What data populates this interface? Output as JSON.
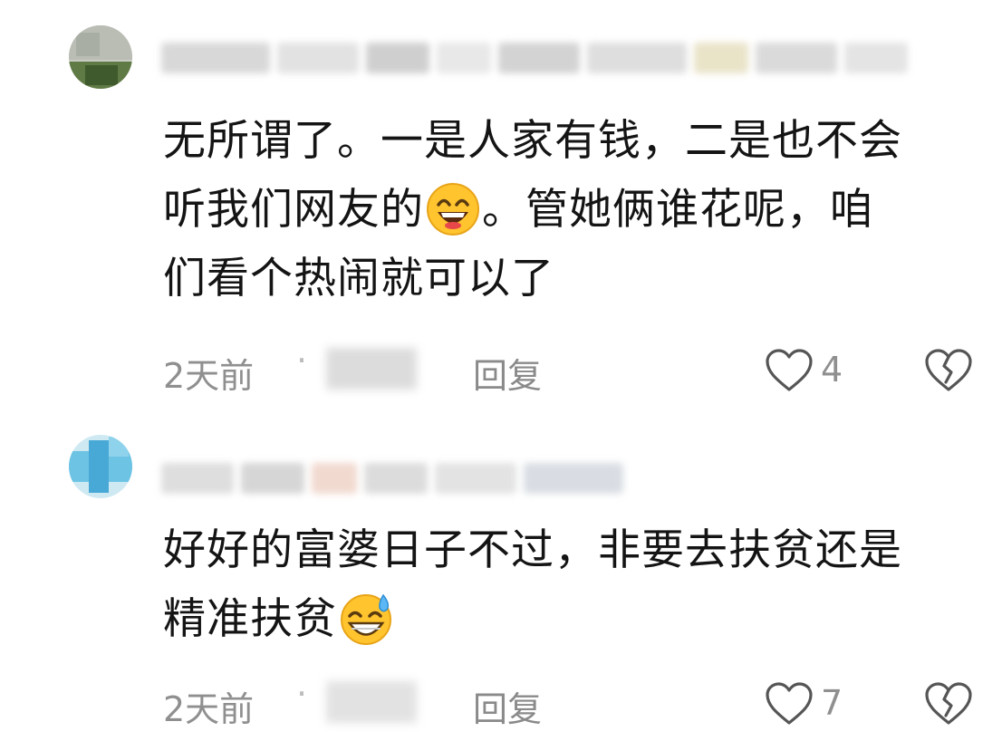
{
  "comments": [
    {
      "text_lines": [
        "无所谓了。一是人家有钱，二是也不会",
        "听我们网友的",
        "。管她俩谁花呢，咱",
        "们看个热闹就可以了"
      ],
      "emoji_after_line_1": "grin-emoji",
      "time": "2天前",
      "separator": "·",
      "reply_label": "回复",
      "like_count": "4"
    },
    {
      "text_lines": [
        "好好的富婆日子不过，非要去扶贫还是",
        "精准扶贫"
      ],
      "emoji_after_line_1": "sweat-smile-emoji",
      "time": "2天前",
      "separator": "·",
      "reply_label": "回复",
      "like_count": "7"
    }
  ],
  "icons": {
    "like": "heart-outline-icon",
    "dislike": "broken-heart-icon"
  },
  "colors": {
    "text": "#141414",
    "meta": "#8f8f8f",
    "background": "#ffffff"
  }
}
